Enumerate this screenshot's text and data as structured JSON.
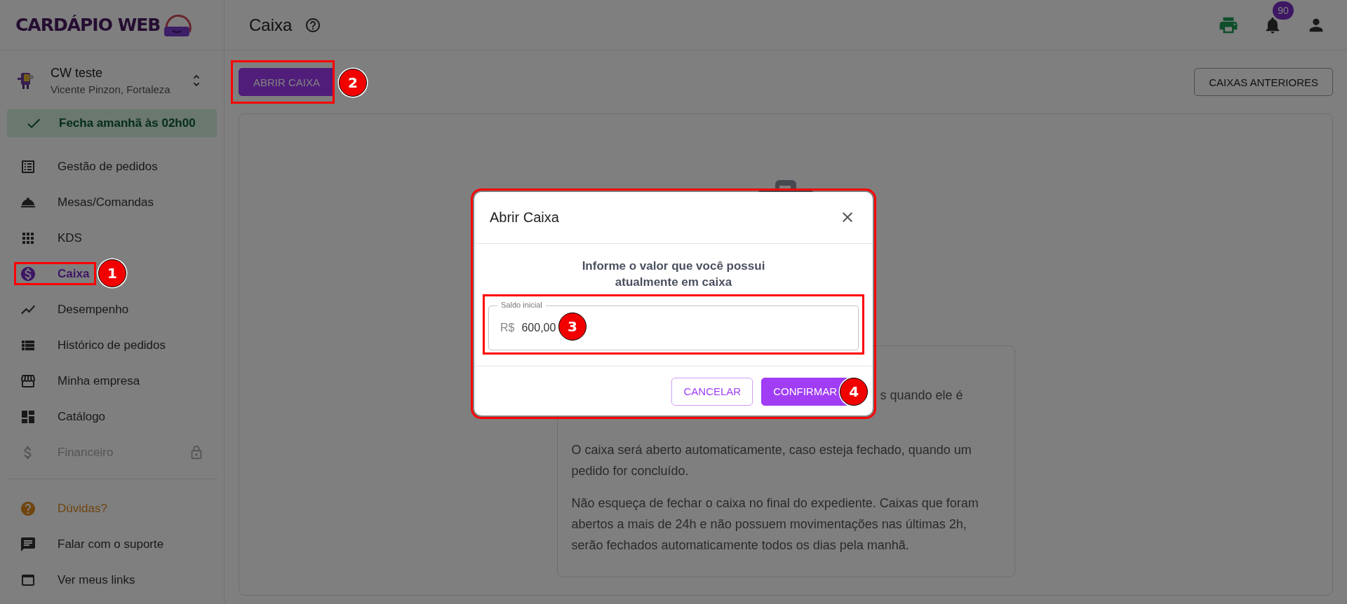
{
  "logo": {
    "text": "CARDÁPIO WEB"
  },
  "store": {
    "name": "CW teste",
    "address": "Vicente Pinzon, Fortaleza"
  },
  "status": {
    "text": "Fecha amanhã às 02h00"
  },
  "menu": [
    {
      "label": "Gestão de pedidos",
      "selected": false,
      "locked": false
    },
    {
      "label": "Mesas/Comandas",
      "selected": false,
      "locked": false
    },
    {
      "label": "KDS",
      "selected": false,
      "locked": false
    },
    {
      "label": "Caixa",
      "selected": true,
      "locked": false,
      "callout": "1"
    },
    {
      "label": "Desempenho",
      "selected": false,
      "locked": false
    },
    {
      "label": "Histórico de pedidos",
      "selected": false,
      "locked": false
    },
    {
      "label": "Minha empresa",
      "selected": false,
      "locked": false
    },
    {
      "label": "Catálogo",
      "selected": false,
      "locked": false
    },
    {
      "label": "Financeiro",
      "selected": false,
      "locked": true
    }
  ],
  "support": [
    {
      "label": "Dúvidas?",
      "kind": "help"
    },
    {
      "label": "Falar com o suporte",
      "kind": "link"
    },
    {
      "label": "Ver meus links",
      "kind": "link"
    }
  ],
  "header": {
    "title": "Caixa",
    "notifications": "90"
  },
  "toolbar": {
    "open_button": {
      "label": "ABRIR CAIXA",
      "callout": "2"
    },
    "history_button": {
      "label": "CAIXAS ANTERIORES"
    }
  },
  "info": {
    "fragment": "s quando ele é",
    "paragraphs": [
      "O caixa será aberto automaticamente, caso esteja fechado, quando um pedido for concluído.",
      "Não esqueça de fechar o caixa no final do expediente. Caixas que foram abertos a mais de 24h e não possuem movimentações nas últimas 2h, serão fechados automaticamente todos os dias pela manhã."
    ]
  },
  "modal": {
    "title": "Abrir Caixa",
    "highlighted": true,
    "prompt_lines": [
      "Informe o valor que você possui",
      "atualmente em caixa"
    ],
    "field": {
      "label": "Saldo inicial",
      "prefix": "R$",
      "value": "600,00",
      "callout": "3"
    },
    "buttons": [
      {
        "label": "CANCELAR",
        "kind": "outline"
      },
      {
        "label": "CONFIRMAR",
        "kind": "primary",
        "callout": "4"
      }
    ]
  }
}
